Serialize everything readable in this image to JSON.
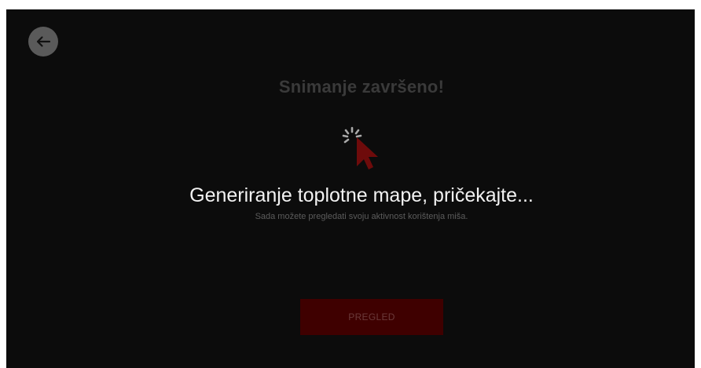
{
  "header": {
    "back_icon": "arrow-left-icon"
  },
  "main": {
    "title": "Snimanje završeno!",
    "loading_icon": "spinner-cursor-icon",
    "heading": "Generiranje toplotne mape, pričekajte...",
    "subtext": "Sada možete pregledati svoju aktivnost korištenja miša.",
    "review_label": "PREGLED"
  },
  "colors": {
    "background": "#0c0c0c",
    "accent": "#3f0000",
    "cursor": "#6e0b0b",
    "heading": "#f2f2f2"
  }
}
